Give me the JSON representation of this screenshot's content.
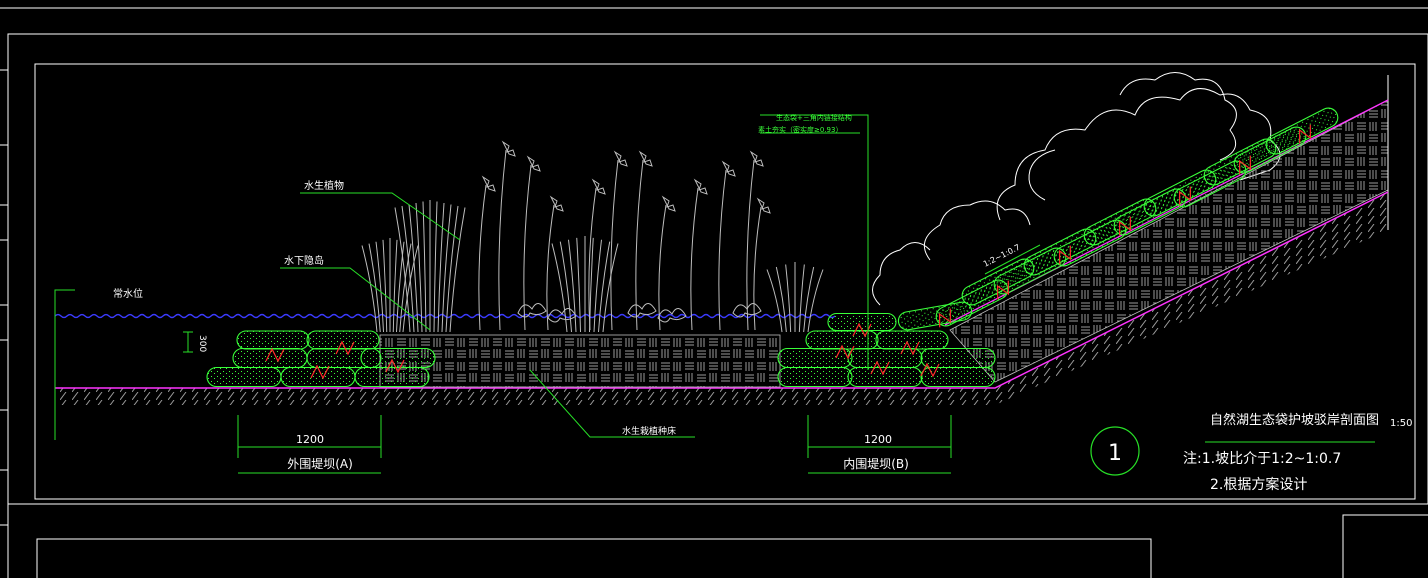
{
  "drawing": {
    "title": "自然湖生态袋护坡驳岸剖面图",
    "scale": "1:50",
    "section_number": "1",
    "notes": [
      "注:1.坡比介于1:2~1:0.7",
      "2.根据方案设计"
    ],
    "labels": {
      "water_level": "常水位",
      "aquatic_plants": "水生植物",
      "underwater_island": "水下隐岛",
      "planting_bed": "水生栽植种床",
      "layer1": "生态袋+三角内链接结构",
      "layer2": "素土夯实（密实度≥0.93）",
      "height": "300",
      "slope": "1:2~1:0.7"
    },
    "dims": [
      {
        "value": "1200",
        "caption": "外围堤坝(A)"
      },
      {
        "value": "1200",
        "caption": "内围堤坝(B)"
      }
    ]
  },
  "colors": {
    "frame": "#ffffff",
    "bag": "#39ff39",
    "ground": "#ff33ff",
    "water": "#3b3bff",
    "plant": "#bdbdbd",
    "hatch": "#9a9a9a",
    "cross": "#ff2a2a",
    "dim": "#27e027"
  }
}
